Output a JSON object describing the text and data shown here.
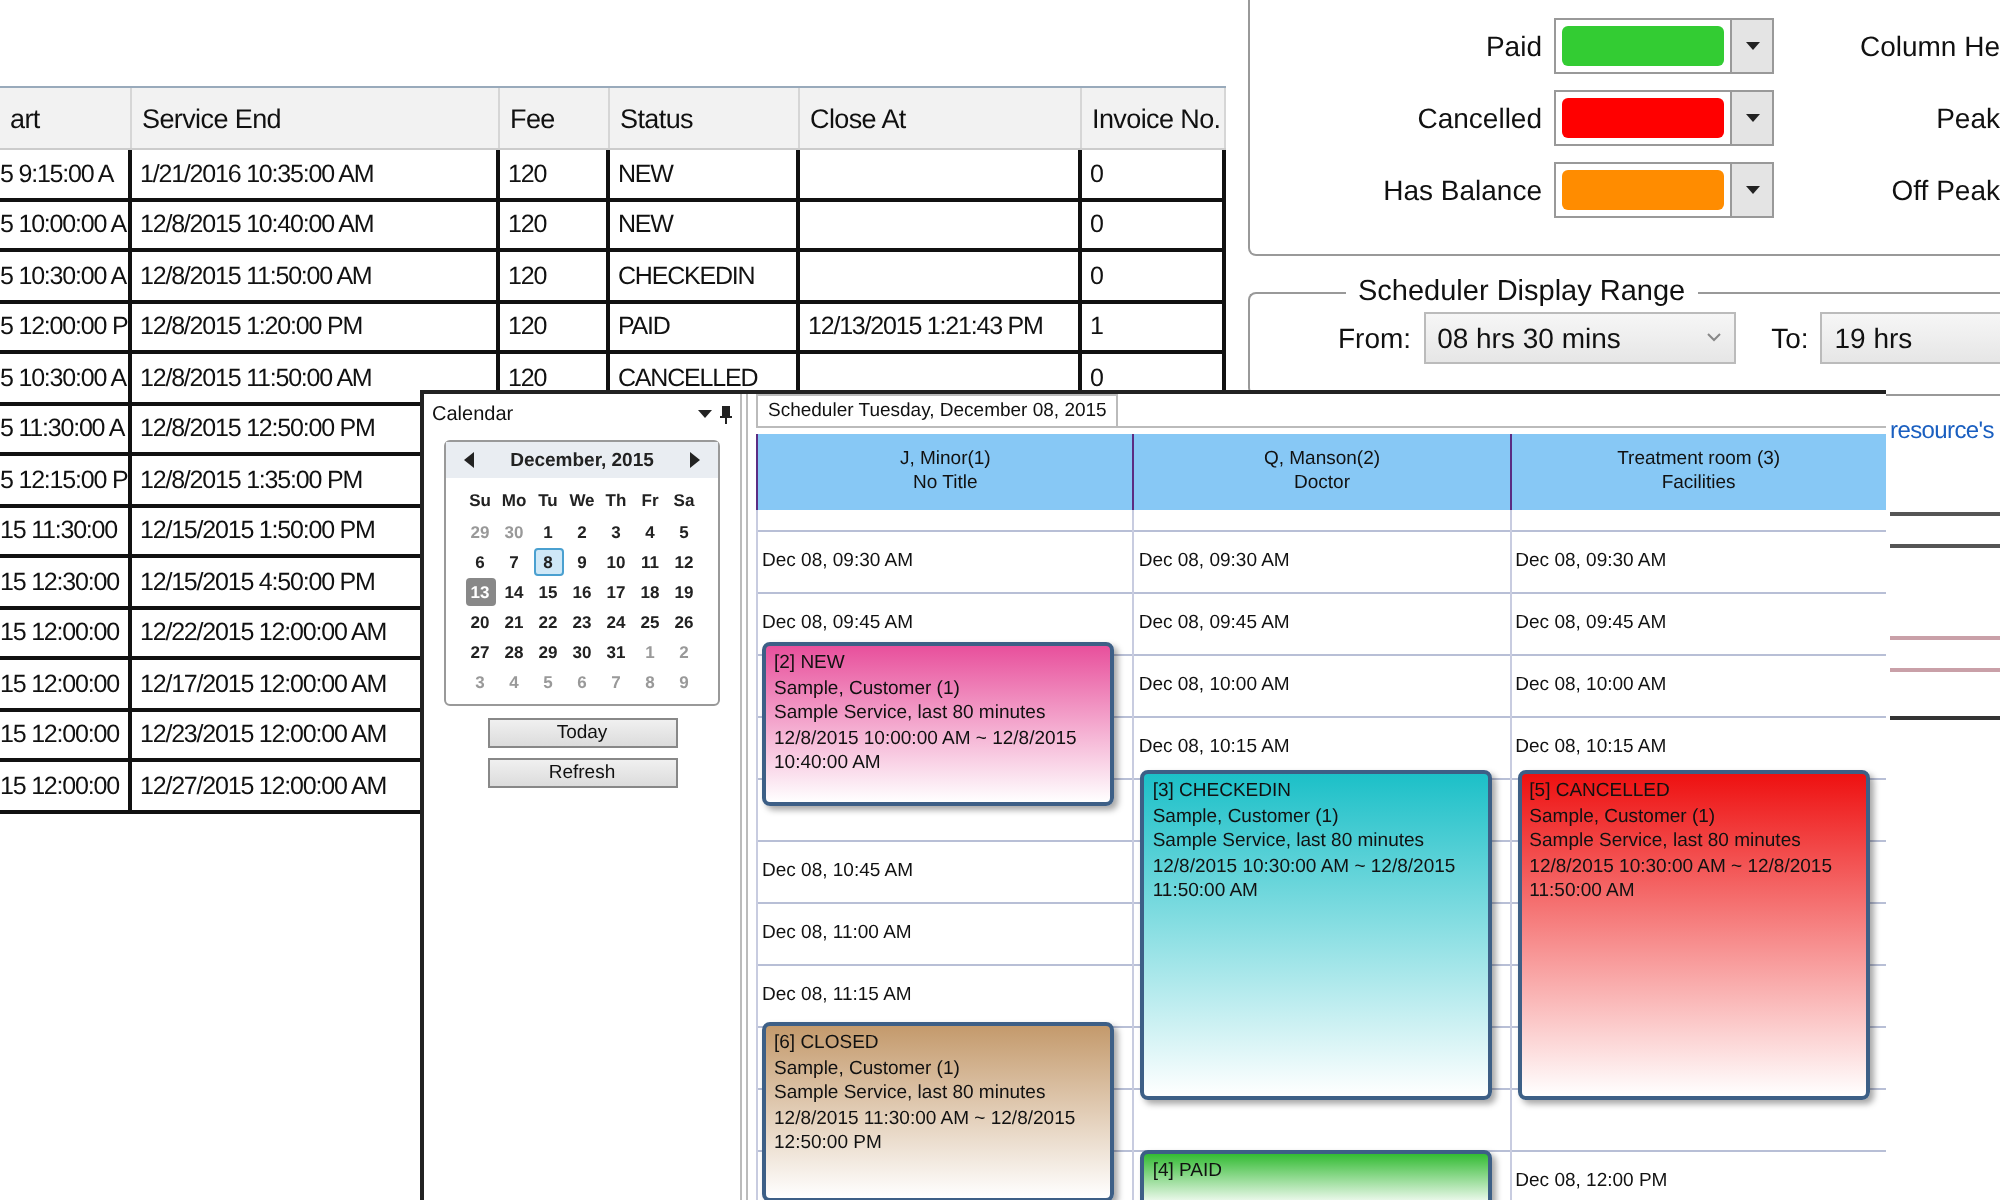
{
  "table_window": {
    "columns": [
      "art",
      "Service End",
      "Fee",
      "Status",
      "Close At",
      "Invoice No."
    ],
    "rows": [
      {
        "cells": [
          "5 9:15:00 A",
          "1/21/2016 10:35:00 AM",
          "120",
          "NEW",
          "",
          "0"
        ]
      },
      {
        "cells": [
          "5 10:00:00 A",
          "12/8/2015 10:40:00 AM",
          "120",
          "NEW",
          "",
          "0"
        ]
      },
      {
        "cells": [
          "5 10:30:00 A",
          "12/8/2015 11:50:00 AM",
          "120",
          "CHECKEDIN",
          "",
          "0"
        ]
      },
      {
        "cells": [
          "5 12:00:00 P",
          "12/8/2015 1:20:00 PM",
          "120",
          "PAID",
          "12/13/2015 1:21:43 PM",
          "1"
        ]
      },
      {
        "cells": [
          "5 10:30:00 A",
          "12/8/2015 11:50:00 AM",
          "120",
          "CANCELLED",
          "",
          "0"
        ]
      },
      {
        "cells": [
          "5 11:30:00 A",
          "12/8/2015 12:50:00 PM"
        ]
      },
      {
        "cells": [
          "5 12:15:00 P",
          "12/8/2015 1:35:00 PM"
        ]
      },
      {
        "cells": [
          "15 11:30:00",
          "12/15/2015 1:50:00 PM"
        ]
      },
      {
        "cells": [
          "15 12:30:00",
          "12/15/2015 4:50:00 PM"
        ]
      },
      {
        "cells": [
          "15 12:00:00",
          "12/22/2015 12:00:00 AM"
        ]
      },
      {
        "cells": [
          "15 12:00:00",
          "12/17/2015 12:00:00 AM"
        ]
      },
      {
        "cells": [
          "15 12:00:00",
          "12/23/2015 12:00:00 AM"
        ]
      },
      {
        "cells": [
          "15 12:00:00",
          "12/27/2015 12:00:00 AM"
        ]
      }
    ]
  },
  "settings": {
    "status_colors": [
      {
        "label": "Paid",
        "color": "#33cc33"
      },
      {
        "label": "Cancelled",
        "color": "#ff0000"
      },
      {
        "label": "Has Balance",
        "color": "#ff8c00"
      }
    ],
    "right_labels": [
      "Column He",
      "Peak",
      "Off Peak"
    ],
    "display_range": {
      "title": "Scheduler Display Range",
      "from_label": "From:",
      "from_value": "08 hrs 30 mins",
      "to_label": "To:",
      "to_value": "19 hrs"
    },
    "link": "resource's"
  },
  "calendar": {
    "title": "Calendar",
    "month": "December, 2015",
    "weekdays": [
      "Su",
      "Mo",
      "Tu",
      "We",
      "Th",
      "Fr",
      "Sa"
    ],
    "weeks": [
      [
        {
          "d": "29",
          "muted": true,
          "selected": false,
          "today": false
        },
        {
          "d": "30",
          "muted": true,
          "selected": false,
          "today": false
        },
        {
          "d": "1",
          "muted": false,
          "selected": false,
          "today": false
        },
        {
          "d": "2",
          "muted": false,
          "selected": false,
          "today": false
        },
        {
          "d": "3",
          "muted": false,
          "selected": false,
          "today": false
        },
        {
          "d": "4",
          "muted": false,
          "selected": false,
          "today": false
        },
        {
          "d": "5",
          "muted": false,
          "selected": false,
          "today": false
        }
      ],
      [
        {
          "d": "6",
          "muted": false,
          "selected": false,
          "today": false
        },
        {
          "d": "7",
          "muted": false,
          "selected": false,
          "today": false
        },
        {
          "d": "8",
          "muted": false,
          "selected": true,
          "today": false
        },
        {
          "d": "9",
          "muted": false,
          "selected": false,
          "today": false
        },
        {
          "d": "10",
          "muted": false,
          "selected": false,
          "today": false
        },
        {
          "d": "11",
          "muted": false,
          "selected": false,
          "today": false
        },
        {
          "d": "12",
          "muted": false,
          "selected": false,
          "today": false
        }
      ],
      [
        {
          "d": "13",
          "muted": false,
          "selected": false,
          "today": true
        },
        {
          "d": "14",
          "muted": false,
          "selected": false,
          "today": false
        },
        {
          "d": "15",
          "muted": false,
          "selected": false,
          "today": false
        },
        {
          "d": "16",
          "muted": false,
          "selected": false,
          "today": false
        },
        {
          "d": "17",
          "muted": false,
          "selected": false,
          "today": false
        },
        {
          "d": "18",
          "muted": false,
          "selected": false,
          "today": false
        },
        {
          "d": "19",
          "muted": false,
          "selected": false,
          "today": false
        }
      ],
      [
        {
          "d": "20",
          "muted": false,
          "selected": false,
          "today": false
        },
        {
          "d": "21",
          "muted": false,
          "selected": false,
          "today": false
        },
        {
          "d": "22",
          "muted": false,
          "selected": false,
          "today": false
        },
        {
          "d": "23",
          "muted": false,
          "selected": false,
          "today": false
        },
        {
          "d": "24",
          "muted": false,
          "selected": false,
          "today": false
        },
        {
          "d": "25",
          "muted": false,
          "selected": false,
          "today": false
        },
        {
          "d": "26",
          "muted": false,
          "selected": false,
          "today": false
        }
      ],
      [
        {
          "d": "27",
          "muted": false,
          "selected": false,
          "today": false
        },
        {
          "d": "28",
          "muted": false,
          "selected": false,
          "today": false
        },
        {
          "d": "29",
          "muted": false,
          "selected": false,
          "today": false
        },
        {
          "d": "30",
          "muted": false,
          "selected": false,
          "today": false
        },
        {
          "d": "31",
          "muted": false,
          "selected": false,
          "today": false
        },
        {
          "d": "1",
          "muted": true,
          "selected": false,
          "today": false
        },
        {
          "d": "2",
          "muted": true,
          "selected": false,
          "today": false
        }
      ],
      [
        {
          "d": "3",
          "muted": true,
          "selected": false,
          "today": false
        },
        {
          "d": "4",
          "muted": true,
          "selected": false,
          "today": false
        },
        {
          "d": "5",
          "muted": true,
          "selected": false,
          "today": false
        },
        {
          "d": "6",
          "muted": true,
          "selected": false,
          "today": false
        },
        {
          "d": "7",
          "muted": true,
          "selected": false,
          "today": false
        },
        {
          "d": "8",
          "muted": true,
          "selected": false,
          "today": false
        },
        {
          "d": "9",
          "muted": true,
          "selected": false,
          "today": false
        }
      ]
    ],
    "buttons": [
      "Today",
      "Refresh"
    ]
  },
  "scheduler": {
    "tab": "Scheduler Tuesday, December 08, 2015",
    "resources": [
      {
        "name": "J, Minor(1)",
        "title": "No Title",
        "slots": [
          "Dec 08, 09:30 AM",
          "Dec 08, 09:45 AM",
          "Dec 08, 10:45 AM",
          "Dec 08, 11:00 AM",
          "Dec 08, 11:15 AM"
        ],
        "appointments": [
          {
            "heading": "[2] NEW",
            "customer": "Sample, Customer (1)",
            "service": "Sample Service, last 80 minutes",
            "time": "12/8/2015 10:00:00 AM ~ 12/8/2015 10:40:00 AM",
            "color": "#e8509c"
          },
          {
            "heading": "[6] CLOSED",
            "customer": "Sample, Customer (1)",
            "service": "Sample Service, last 80 minutes",
            "time": "12/8/2015 11:30:00 AM ~ 12/8/2015 12:50:00 PM",
            "color": "#c49a6c"
          }
        ]
      },
      {
        "name": "Q, Manson(2)",
        "title": "Doctor",
        "slots": [
          "Dec 08, 09:30 AM",
          "Dec 08, 09:45 AM",
          "Dec 08, 10:00 AM",
          "Dec 08, 10:15 AM"
        ],
        "appointments": [
          {
            "heading": "[3] CHECKEDIN",
            "customer": "Sample, Customer (1)",
            "service": "Sample Service, last 80 minutes",
            "time": "12/8/2015 10:30:00 AM ~ 12/8/2015 11:50:00 AM",
            "color": "#1cc0c8"
          },
          {
            "heading": "[4] PAID",
            "color": "#33bb33"
          }
        ]
      },
      {
        "name": "Treatment room (3)",
        "title": "Facilities",
        "slots": [
          "Dec 08, 09:30 AM",
          "Dec 08, 09:45 AM",
          "Dec 08, 10:00 AM",
          "Dec 08, 10:15 AM",
          "Dec 08, 12:00 PM"
        ],
        "appointments": [
          {
            "heading": "[5] CANCELLED",
            "customer": "Sample, Customer (1)",
            "service": "Sample Service, last 80 minutes",
            "time": "12/8/2015 10:30:00 AM ~ 12/8/2015 11:50:00 AM",
            "color": "#ee1111"
          }
        ]
      }
    ]
  }
}
